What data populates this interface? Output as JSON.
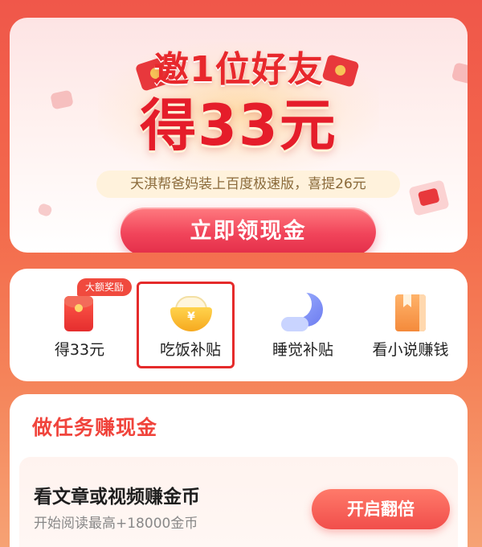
{
  "promo": {
    "headline_line1": "邀1位好友",
    "headline_line2": "得33元",
    "ticker": "天淇帮爸妈装上百度极速版，喜提26元",
    "claim_button": "立即领现金"
  },
  "features": {
    "items": [
      {
        "label": "得33元",
        "badge": "大额奖励",
        "icon": "red-envelope-icon"
      },
      {
        "label": "吃饭补贴",
        "icon": "rice-bowl-icon",
        "icon_glyph": "¥"
      },
      {
        "label": "睡觉补贴",
        "icon": "moon-icon"
      },
      {
        "label": "看小说赚钱",
        "icon": "book-icon"
      }
    ]
  },
  "tasks": {
    "title": "做任务赚现金",
    "items": [
      {
        "name": "看文章或视频赚金币",
        "desc": "开始阅读最高+18000金币",
        "button": "开启翻倍"
      }
    ]
  },
  "colors": {
    "accent_red": "#e51d2a",
    "button_gradient_top": "#ff7b80",
    "button_gradient_bottom": "#e22d48",
    "highlight_border": "#e52b2b"
  }
}
